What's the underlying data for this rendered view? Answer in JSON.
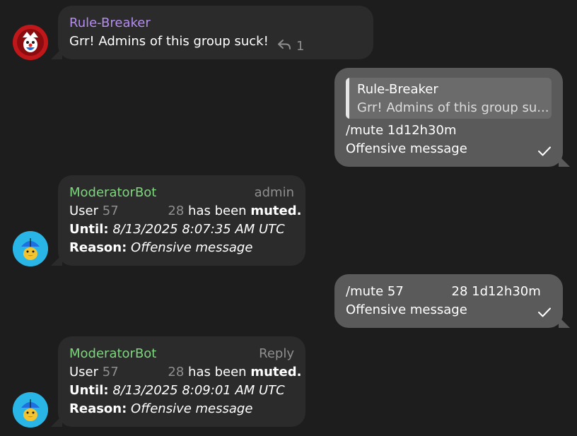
{
  "messages": [
    {
      "sender": "Rule-Breaker",
      "text": "Grr! Admins of this group suck!",
      "reply_count": "1",
      "colors": {
        "sender": "#b58df0",
        "avatar": "#c0171a"
      }
    },
    {
      "quote": {
        "sender": "Rule-Breaker",
        "text": "Grr! Admins of this group su..."
      },
      "line1": "/mute 1d12h30m",
      "line2": "Offensive message"
    },
    {
      "sender": "ModeratorBot",
      "badge": "admin",
      "user_label": "User",
      "user_id_a": "57",
      "user_id_b": "28",
      "muted_prefix": "has been",
      "muted_word": "muted.",
      "until_label": "Until:",
      "until_value": "8/13/2025 8:07:35 AM UTC",
      "reason_label": "Reason:",
      "reason_value": "Offensive message",
      "colors": {
        "sender": "#7ed67e",
        "avatar": "#29b6e6"
      }
    },
    {
      "line1_a": "/mute 57",
      "line1_b": "28 1d12h30m",
      "line2": "Offensive message"
    },
    {
      "sender": "ModeratorBot",
      "badge": "Reply",
      "user_label": "User",
      "user_id_a": "57",
      "user_id_b": "28",
      "muted_prefix": "has been",
      "muted_word": "muted.",
      "until_label": "Until:",
      "until_value": "8/13/2025 8:09:01 AM UTC",
      "reason_label": "Reason:",
      "reason_value": "Offensive message",
      "colors": {
        "sender": "#7ed67e",
        "avatar": "#29b6e6"
      }
    }
  ],
  "icons": {
    "reply": "reply-arrow-icon",
    "check": "check-icon"
  }
}
